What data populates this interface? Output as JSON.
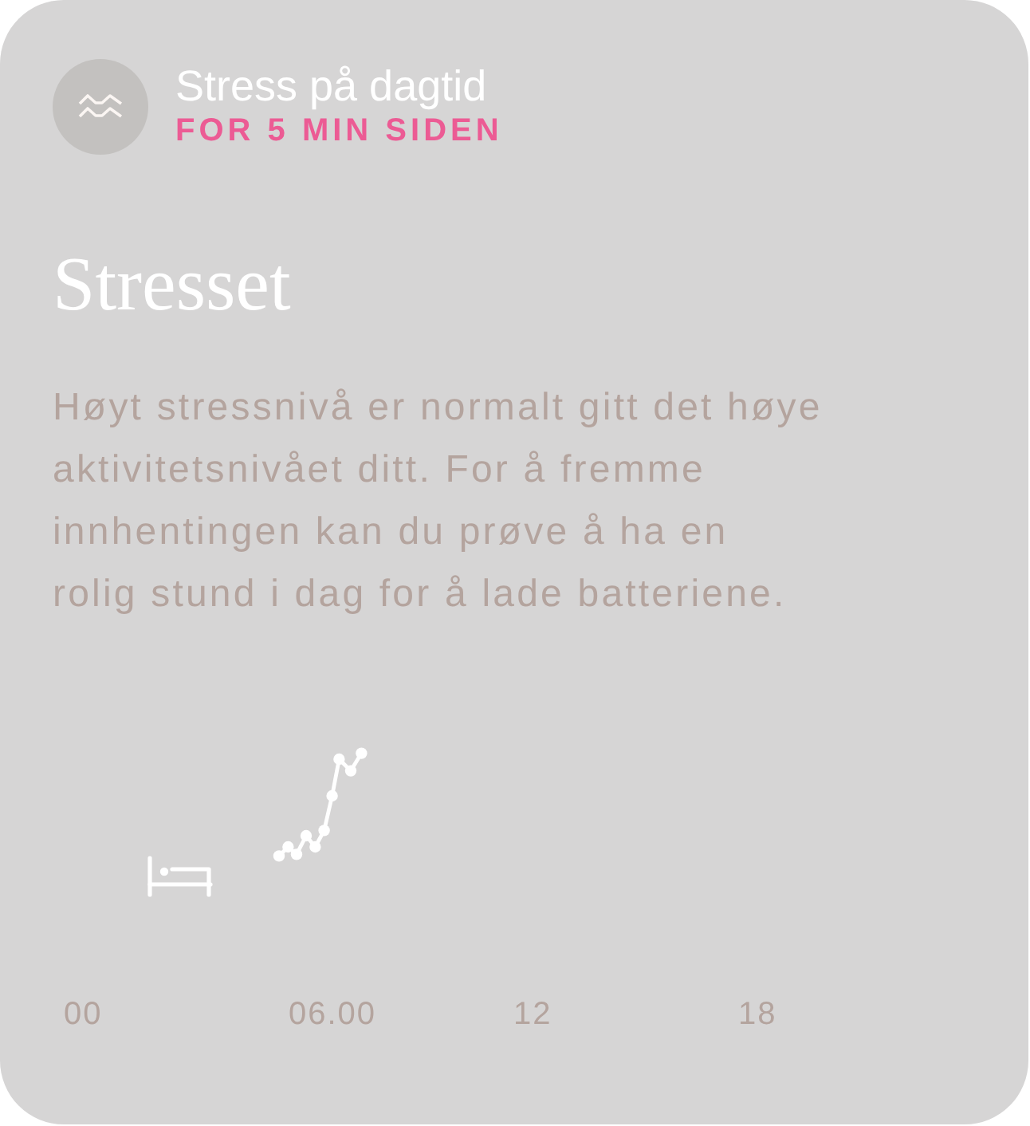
{
  "header": {
    "title": "Stress på dagtid",
    "timestamp": "FOR 5 MIN SIDEN"
  },
  "status": {
    "heading": "Stresset",
    "description_lines": [
      "Høyt stressnivå er normalt gitt det høye",
      "aktivitetsnivået ditt. For å fremme",
      "innhentingen kan du prøve å ha en",
      "rolig stund i dag for å lade batteriene."
    ]
  },
  "chart": {
    "x_labels": [
      "00",
      "06.00",
      "12",
      "18"
    ]
  }
}
